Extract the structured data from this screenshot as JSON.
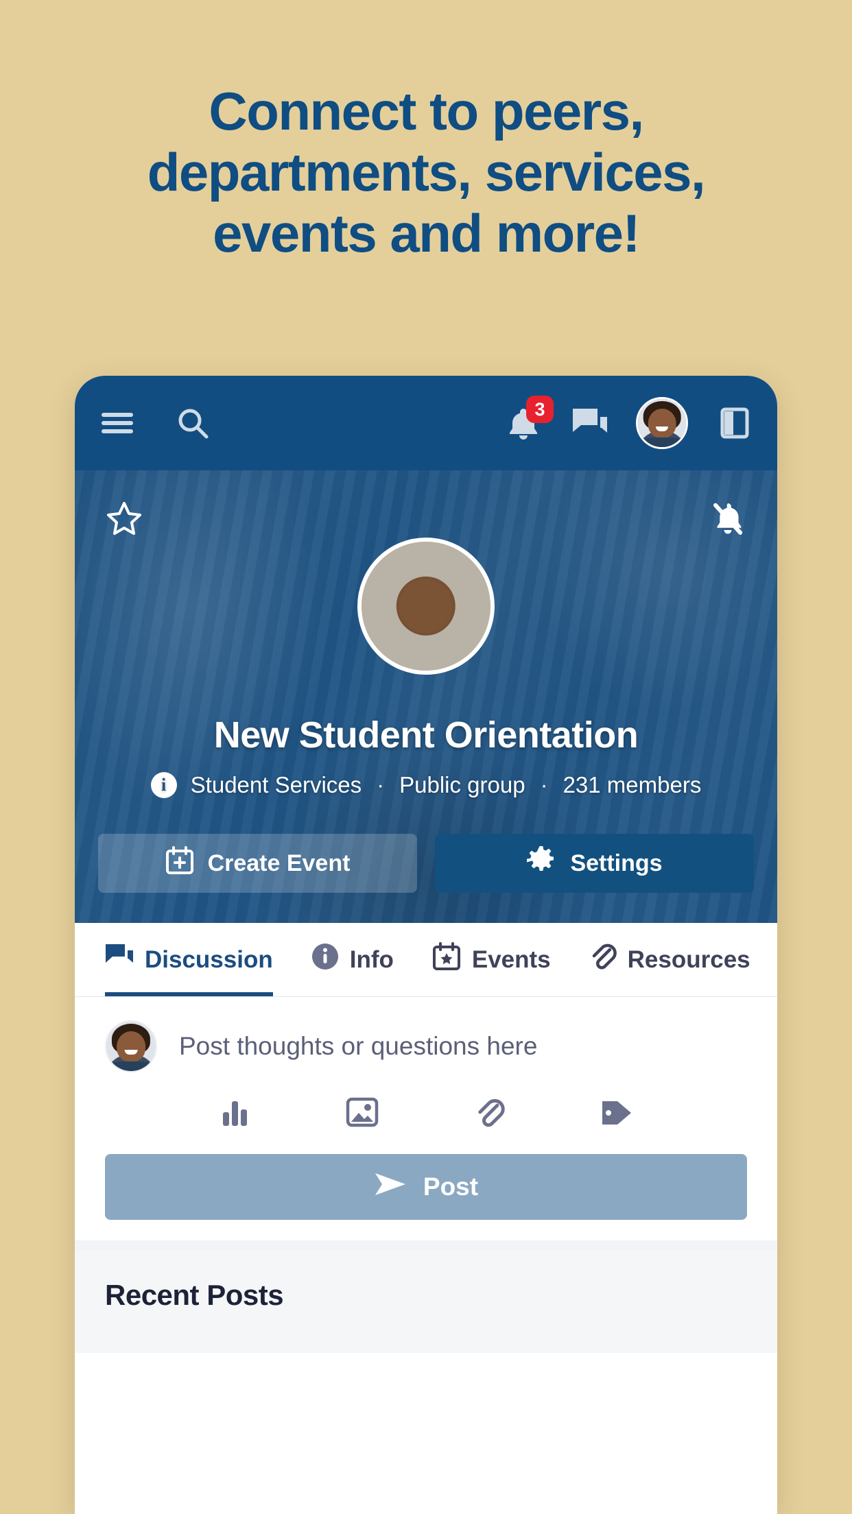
{
  "headline": {
    "lines": [
      "Connect to peers,",
      "departments, services,",
      "events and more!"
    ],
    "color": "#0f4d82"
  },
  "appbar": {
    "menu_icon": "hamburger-menu-icon",
    "search_icon": "search-icon",
    "notifications_icon": "bell-icon",
    "notifications_badge": "3",
    "messages_icon": "chat-bubbles-icon",
    "profile_avatar": "user-avatar",
    "panel_icon": "side-panel-icon",
    "background": "#124d82",
    "badge_color": "#e8212f"
  },
  "hero": {
    "favorite_icon": "star-outline-icon",
    "mute_icon": "bell-off-icon",
    "group_avatar": "hands-together-photo",
    "title": "New Student Orientation",
    "meta": {
      "info_icon": "info-icon",
      "department": "Student Services",
      "visibility": "Public group",
      "members": "231 members",
      "separator": "·"
    },
    "actions": [
      {
        "label": "Create Event",
        "icon": "calendar-plus-icon",
        "style": "ghost"
      },
      {
        "label": "Settings",
        "icon": "gear-icon",
        "style": "primary"
      }
    ]
  },
  "tabs": [
    {
      "label": "Discussion",
      "icon": "chat-bubbles-icon",
      "active": true
    },
    {
      "label": "Info",
      "icon": "info-icon",
      "active": false
    },
    {
      "label": "Events",
      "icon": "calendar-star-icon",
      "active": false
    },
    {
      "label": "Resources",
      "icon": "paperclip-icon",
      "active": false
    }
  ],
  "composer": {
    "avatar": "user-avatar",
    "placeholder": "Post thoughts or questions here",
    "tools": [
      {
        "icon": "poll-bar-chart-icon"
      },
      {
        "icon": "image-icon"
      },
      {
        "icon": "paperclip-icon"
      },
      {
        "icon": "tag-icon"
      }
    ],
    "post_label": "Post",
    "post_icon": "send-icon",
    "post_button_color": "#8ba8c2"
  },
  "recent": {
    "title": "Recent Posts"
  }
}
